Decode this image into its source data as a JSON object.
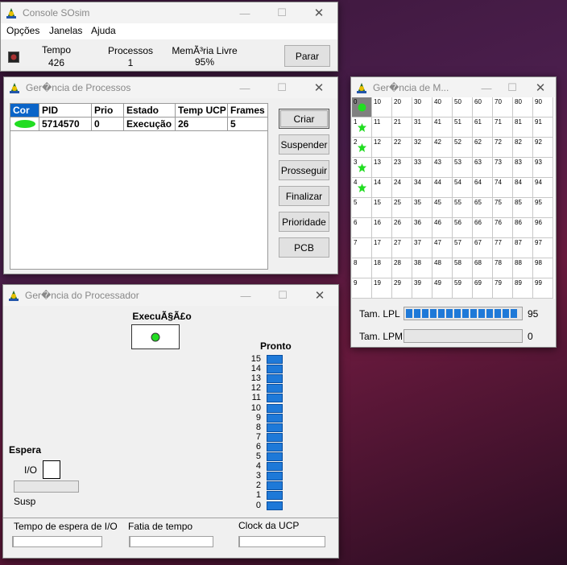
{
  "console": {
    "title": "Console SOsim",
    "menu": [
      "Opções",
      "Janelas",
      "Ajuda"
    ],
    "stats": [
      {
        "label": "Tempo",
        "value": "426"
      },
      {
        "label": "Processos",
        "value": "1"
      },
      {
        "label": "MemÃ³ria Livre",
        "value": "95%"
      }
    ],
    "stop_button": "Parar"
  },
  "processes": {
    "title": "Ger�ncia de Processos",
    "columns": [
      "Cor",
      "PID",
      "Prio",
      "Estado",
      "Temp UCP",
      "Frames"
    ],
    "rows": [
      {
        "color": "#22dd22",
        "pid": "5714570",
        "prio": "0",
        "state": "Execução",
        "cpu_time": "26",
        "frames": "5"
      }
    ],
    "buttons": [
      "Criar",
      "Suspender",
      "Prosseguir",
      "Finalizar",
      "Prioridade",
      "PCB"
    ]
  },
  "memory": {
    "title": "Ger�ncia de M...",
    "cells": [
      0,
      10,
      20,
      30,
      40,
      50,
      60,
      70,
      80,
      90,
      1,
      11,
      21,
      31,
      41,
      51,
      61,
      71,
      81,
      91,
      2,
      12,
      22,
      32,
      42,
      52,
      62,
      72,
      82,
      92,
      3,
      13,
      23,
      33,
      43,
      53,
      63,
      73,
      83,
      93,
      4,
      14,
      24,
      34,
      44,
      54,
      64,
      74,
      84,
      94,
      5,
      15,
      25,
      35,
      45,
      55,
      65,
      75,
      85,
      95,
      6,
      16,
      26,
      36,
      46,
      56,
      66,
      76,
      86,
      96,
      7,
      17,
      27,
      37,
      47,
      57,
      67,
      77,
      87,
      97,
      8,
      18,
      28,
      38,
      48,
      58,
      68,
      78,
      88,
      98,
      9,
      19,
      29,
      39,
      49,
      59,
      69,
      79,
      89,
      99
    ],
    "occupied_frames": [
      0,
      1,
      2,
      3,
      4
    ],
    "lpl_label": "Tam. LPL",
    "lpl_value": "95",
    "lpl_fill": 0.95,
    "lpm_label": "Tam. LPM",
    "lpm_value": "0"
  },
  "processor": {
    "title": "Ger�ncia do Processador",
    "exec_label": "ExecuÃ§Ã£o",
    "ready_label": "Pronto",
    "ready_levels": [
      "15",
      "14",
      "13",
      "12",
      "11",
      "10",
      "9",
      "8",
      "7",
      "6",
      "5",
      "4",
      "3",
      "2",
      "1",
      "0"
    ],
    "wait_label": "Espera",
    "io_label": "I/O",
    "susp_label": "Susp",
    "sliders": [
      "Tempo de espera de I/O",
      "Fatia de tempo",
      "Clock da UCP"
    ]
  },
  "colors": {
    "running": "#22dd22",
    "accent": "#1e79d8"
  }
}
